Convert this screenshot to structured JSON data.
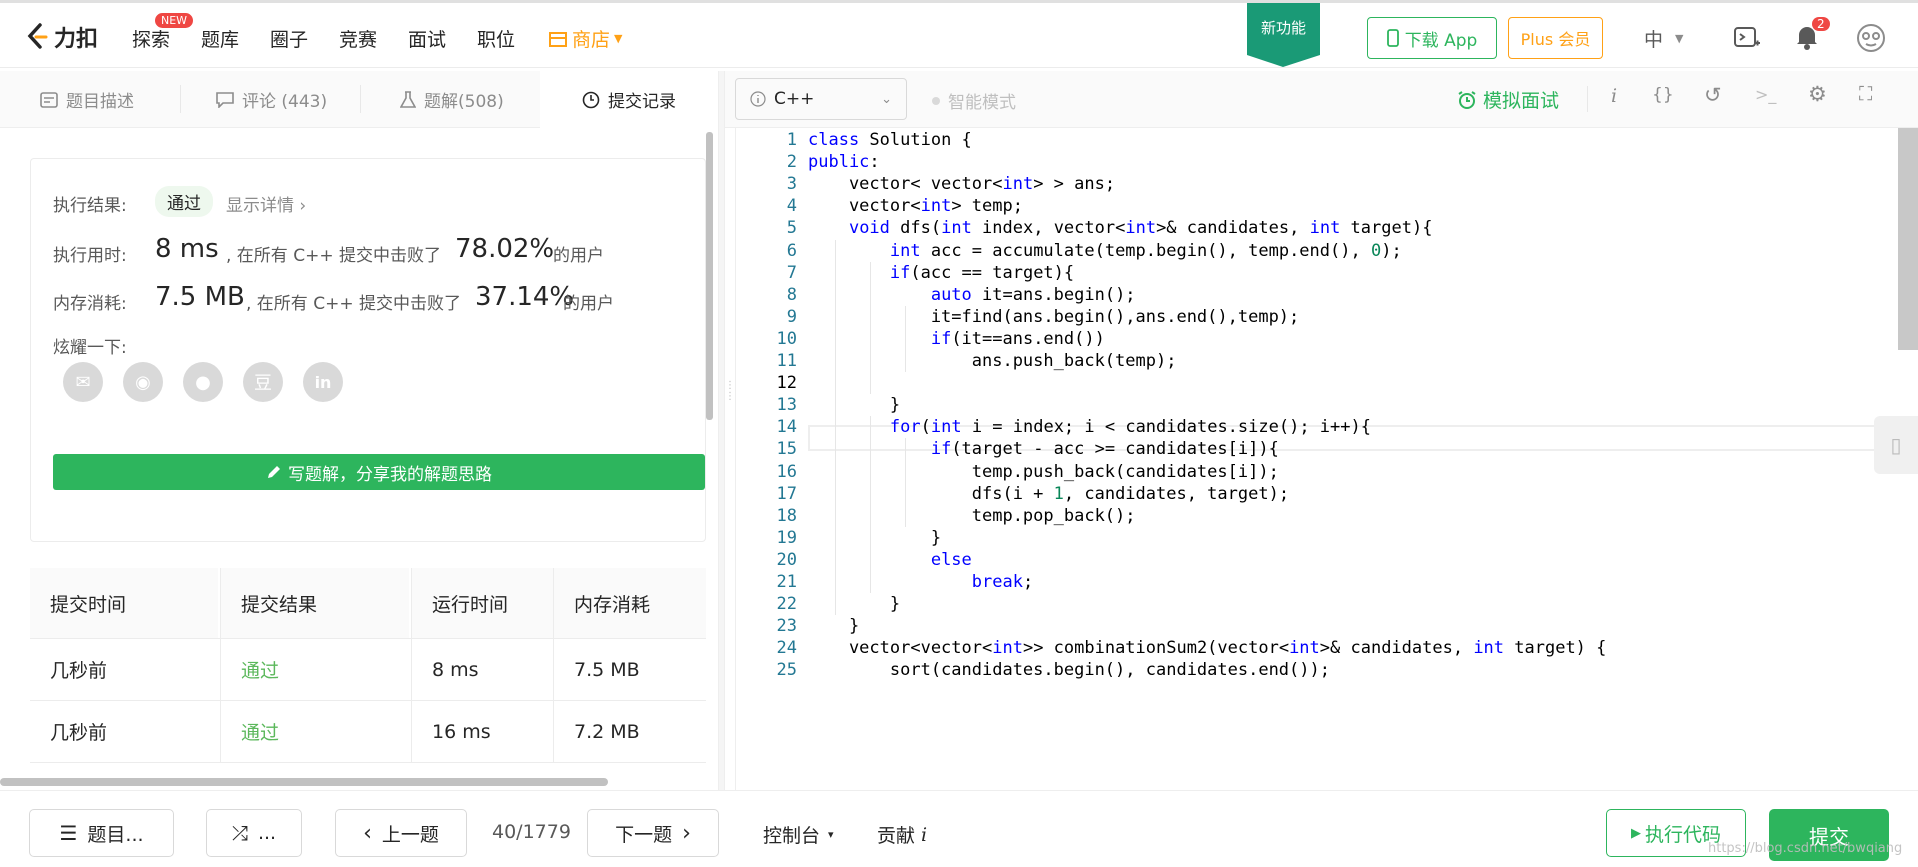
{
  "nav": {
    "logo_text": "力扣",
    "items": [
      "探索",
      "题库",
      "圈子",
      "竞赛",
      "面试",
      "职位"
    ],
    "new_badge": "NEW",
    "store": "商店",
    "new_feature": "新功能",
    "download_app": "下载 App",
    "plus": "Plus 会员",
    "lang": "中",
    "notification_count": "2"
  },
  "left_tabs": [
    {
      "label": "题目描述",
      "icon": "doc-icon"
    },
    {
      "label": "评论 (443)",
      "icon": "comment-icon"
    },
    {
      "label": "题解(508)",
      "icon": "flask-icon"
    },
    {
      "label": "提交记录",
      "icon": "clock-icon"
    }
  ],
  "result": {
    "exec_label": "执行结果:",
    "status": "通过",
    "details": "显示详情 ›",
    "time_label": "执行用时:",
    "time_value": "8 ms",
    "time_text": ", 在所有 C++ 提交中击败了",
    "time_pct": "78.02%",
    "time_suffix": "的用户",
    "mem_label": "内存消耗:",
    "mem_value": "7.5 MB",
    "mem_text": ", 在所有 C++ 提交中击败了",
    "mem_pct": "37.14%",
    "mem_suffix": "的用户",
    "share_label": "炫耀一下:",
    "write_solution": "写题解，分享我的解题思路"
  },
  "submissions": {
    "headers": [
      "提交时间",
      "提交结果",
      "运行时间",
      "内存消耗"
    ],
    "rows": [
      [
        "几秒前",
        "通过",
        "8 ms",
        "7.5 MB"
      ],
      [
        "几秒前",
        "通过",
        "16 ms",
        "7.2 MB"
      ]
    ]
  },
  "editor": {
    "language": "C++",
    "smart_mode": "智能模式",
    "mock_interview": "模拟面试",
    "code_lines": [
      "class Solution {",
      "public:",
      "    vector< vector<int> > ans;",
      "    vector<int> temp;",
      "    void dfs(int index, vector<int>& candidates, int target){",
      "        int acc = accumulate(temp.begin(), temp.end(), 0);",
      "        if(acc == target){",
      "            auto it=ans.begin();",
      "            it=find(ans.begin(),ans.end(),temp);",
      "            if(it==ans.end())",
      "                ans.push_back(temp);",
      "            ",
      "        }",
      "        for(int i = index; i < candidates.size(); i++){",
      "            if(target - acc >= candidates[i]){",
      "                temp.push_back(candidates[i]);",
      "                dfs(i + 1, candidates, target);",
      "                temp.pop_back();",
      "            }",
      "            else",
      "                break;",
      "        }",
      "    }",
      "    vector<vector<int>> combinationSum2(vector<int>& candidates, int target) {",
      "        sort(candidates.begin(), candidates.end());"
    ]
  },
  "bottom": {
    "problem_list": "题目...",
    "random": "...",
    "prev": "上一题",
    "page": "40/1779",
    "next": "下一题",
    "console": "控制台",
    "contribute": "贡献",
    "run": "执行代码",
    "submit": "提交"
  },
  "watermark": "https://blog.csdn.net/bwqiang"
}
